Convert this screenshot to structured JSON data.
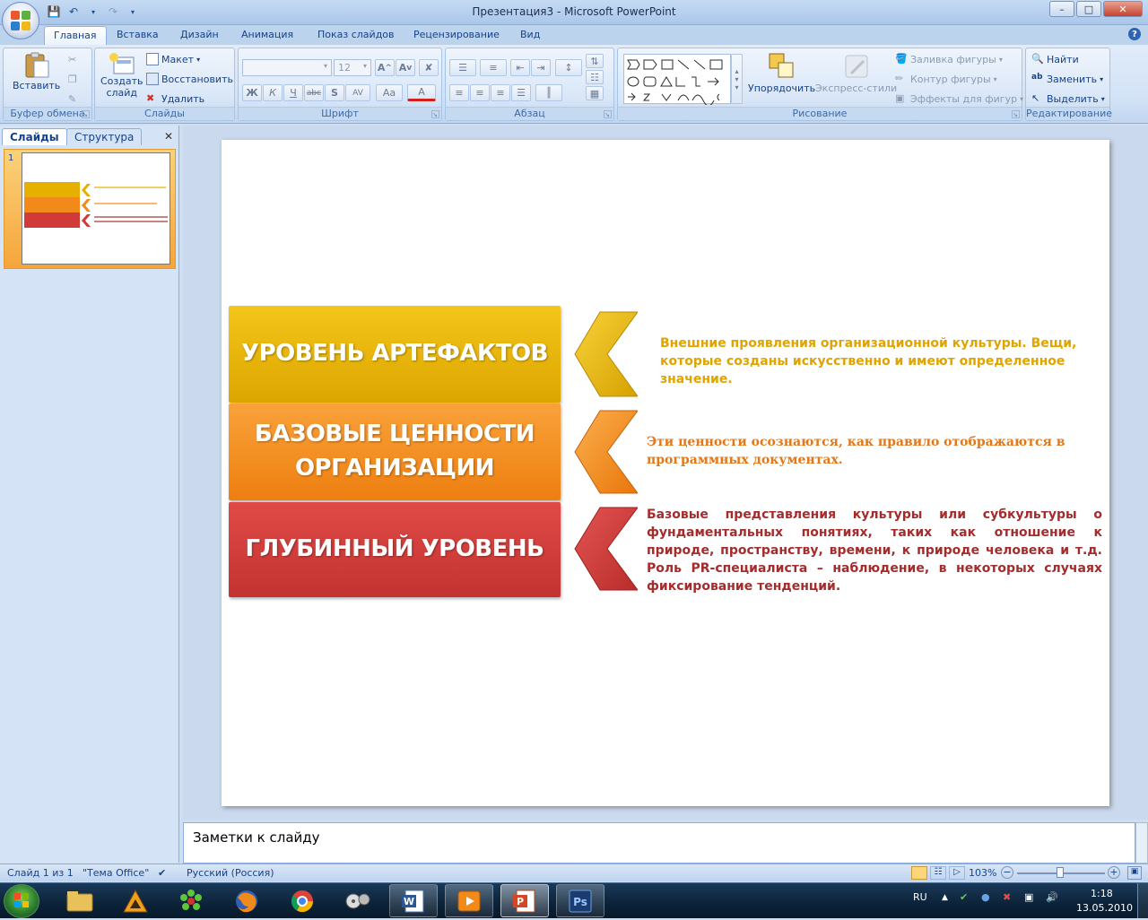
{
  "window": {
    "title": "Презентация3 - Microsoft PowerPoint"
  },
  "ribbon_tabs": [
    "Главная",
    "Вставка",
    "Дизайн",
    "Анимация",
    "Показ слайдов",
    "Рецензирование",
    "Вид"
  ],
  "clipboard": {
    "paste": "Вставить",
    "label": "Буфер обмена"
  },
  "slides_group": {
    "create": "Создать",
    "create2": "слайд",
    "layout": "Макет",
    "reset": "Восстановить",
    "delete": "Удалить",
    "label": "Слайды"
  },
  "font_group": {
    "size": "12",
    "label": "Шрифт"
  },
  "paragraph_group": {
    "label": "Абзац"
  },
  "drawing_group": {
    "arrange": "Упорядочить",
    "quick_styles": "Экспресс-стили",
    "fill": "Заливка фигуры",
    "outline": "Контур фигуры",
    "effects": "Эффекты для фигур",
    "label": "Рисование"
  },
  "editing_group": {
    "find": "Найти",
    "replace": "Заменить",
    "select": "Выделить",
    "label": "Редактирование"
  },
  "left_pane": {
    "tab_slides": "Слайды",
    "tab_outline": "Структура",
    "slide_number": "1"
  },
  "slide": {
    "levels": [
      {
        "title": "УРОВЕНЬ АРТЕФАКТОВ",
        "color": "#e5b000",
        "desc": "Внешние проявления организационной культуры. Вещи, которые созданы искусственно и имеют определенное значение."
      },
      {
        "title": "БАЗОВЫЕ ЦЕННОСТИ ОРГАНИЗАЦИИ",
        "color": "#f28a1a",
        "desc": "Эти ценности осознаются, как правило отображаются в программных документах."
      },
      {
        "title": "ГЛУБИННЫЙ УРОВЕНЬ",
        "color": "#d03a38",
        "desc": "Базовые представления культуры или субкультуры о фундаментальных понятиях, таких как отношение к природе, пространству, времени, к природе человека и т.д. Роль PR-специалиста – наблюдение, в некоторых случаях фиксирование тенденций."
      }
    ]
  },
  "notes": {
    "placeholder": "Заметки к слайду"
  },
  "status": {
    "slide": "Слайд 1 из 1",
    "theme": "\"Тема Office\"",
    "language": "Русский (Россия)",
    "zoom": "103%"
  },
  "taskbar": {
    "lang": "RU",
    "time": "1:18",
    "date": "13.05.2010"
  }
}
